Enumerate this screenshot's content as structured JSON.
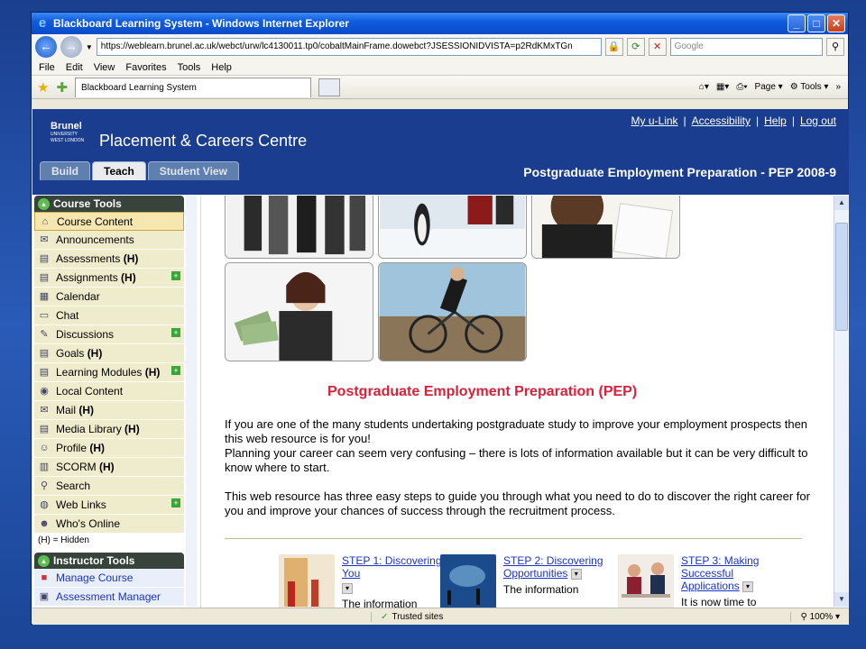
{
  "window": {
    "title": "Blackboard Learning System - Windows Internet Explorer"
  },
  "address": {
    "url": "https://weblearn.brunel.ac.uk/webct/urw/lc4130011.tp0/cobaltMainFrame.dowebct?JSESSIONIDVISTA=p2RdKMxTGn",
    "search_placeholder": "Google"
  },
  "menu": [
    "File",
    "Edit",
    "View",
    "Favorites",
    "Tools",
    "Help"
  ],
  "tab": {
    "label": "Blackboard Learning System"
  },
  "commands": {
    "page": "Page",
    "tools": "Tools"
  },
  "header": {
    "logo_main": "Brunel",
    "logo_sub1": "UNIVERSITY",
    "logo_sub2": "WEST LONDON",
    "site_title": "Placement & Careers Centre",
    "links": [
      "My u-Link",
      "Accessibility",
      "Help",
      "Log out"
    ],
    "tabs": [
      "Build",
      "Teach",
      "Student View"
    ],
    "course_title": "Postgraduate Employment Preparation - PEP 2008-9"
  },
  "course_tools": {
    "title": "Course Tools",
    "items": [
      {
        "label": "Course Content",
        "hidden": "",
        "icon": "home-icon"
      },
      {
        "label": "Announcements",
        "hidden": "",
        "icon": "megaphone-icon"
      },
      {
        "label": "Assessments ",
        "hidden": "(H)",
        "icon": "document-icon"
      },
      {
        "label": "Assignments ",
        "hidden": "(H)",
        "icon": "document-icon"
      },
      {
        "label": "Calendar",
        "hidden": "",
        "icon": "calendar-icon"
      },
      {
        "label": "Chat",
        "hidden": "",
        "icon": "chat-icon"
      },
      {
        "label": "Discussions",
        "hidden": "",
        "icon": "pin-icon"
      },
      {
        "label": "Goals ",
        "hidden": "(H)",
        "icon": "document-icon"
      },
      {
        "label": "Learning Modules ",
        "hidden": "(H)",
        "icon": "document-icon"
      },
      {
        "label": "Local Content",
        "hidden": "",
        "icon": "target-icon"
      },
      {
        "label": "Mail ",
        "hidden": "(H)",
        "icon": "mail-icon"
      },
      {
        "label": "Media Library ",
        "hidden": "(H)",
        "icon": "document-icon"
      },
      {
        "label": "Profile ",
        "hidden": "(H)",
        "icon": "people-icon"
      },
      {
        "label": "SCORM ",
        "hidden": "(H)",
        "icon": "scorm-icon"
      },
      {
        "label": "Search",
        "hidden": "",
        "icon": "search-icon"
      },
      {
        "label": "Web Links",
        "hidden": "",
        "icon": "globe-icon"
      },
      {
        "label": "Who's Online",
        "hidden": "",
        "icon": "person-icon"
      }
    ],
    "hidden_note": "(H) = Hidden"
  },
  "instructor_tools": {
    "title": "Instructor Tools",
    "items": [
      "Manage Course",
      "Assessment Manager"
    ]
  },
  "content": {
    "title": "Postgraduate Employment Preparation (PEP)",
    "para1": "If you are one of the many students undertaking postgraduate study to improve your employment prospects then this web resource is for you!",
    "para2": "Planning your career can seem very confusing – there is lots of information available but it can be very difficult to know where to start.",
    "para3": "This web resource has three easy steps to guide you through what you need to do to discover the right career for you and improve your chances of success through the recruitment process.",
    "steps": [
      {
        "title": "STEP 1: Discovering You",
        "desc": "The information"
      },
      {
        "title": "STEP 2: Discovering Opportunities",
        "desc": "The information"
      },
      {
        "title": "STEP 3: Making Successful Applications",
        "desc": "It is now time to"
      }
    ]
  },
  "status": {
    "zone": "Trusted sites",
    "zoom": "100%"
  }
}
